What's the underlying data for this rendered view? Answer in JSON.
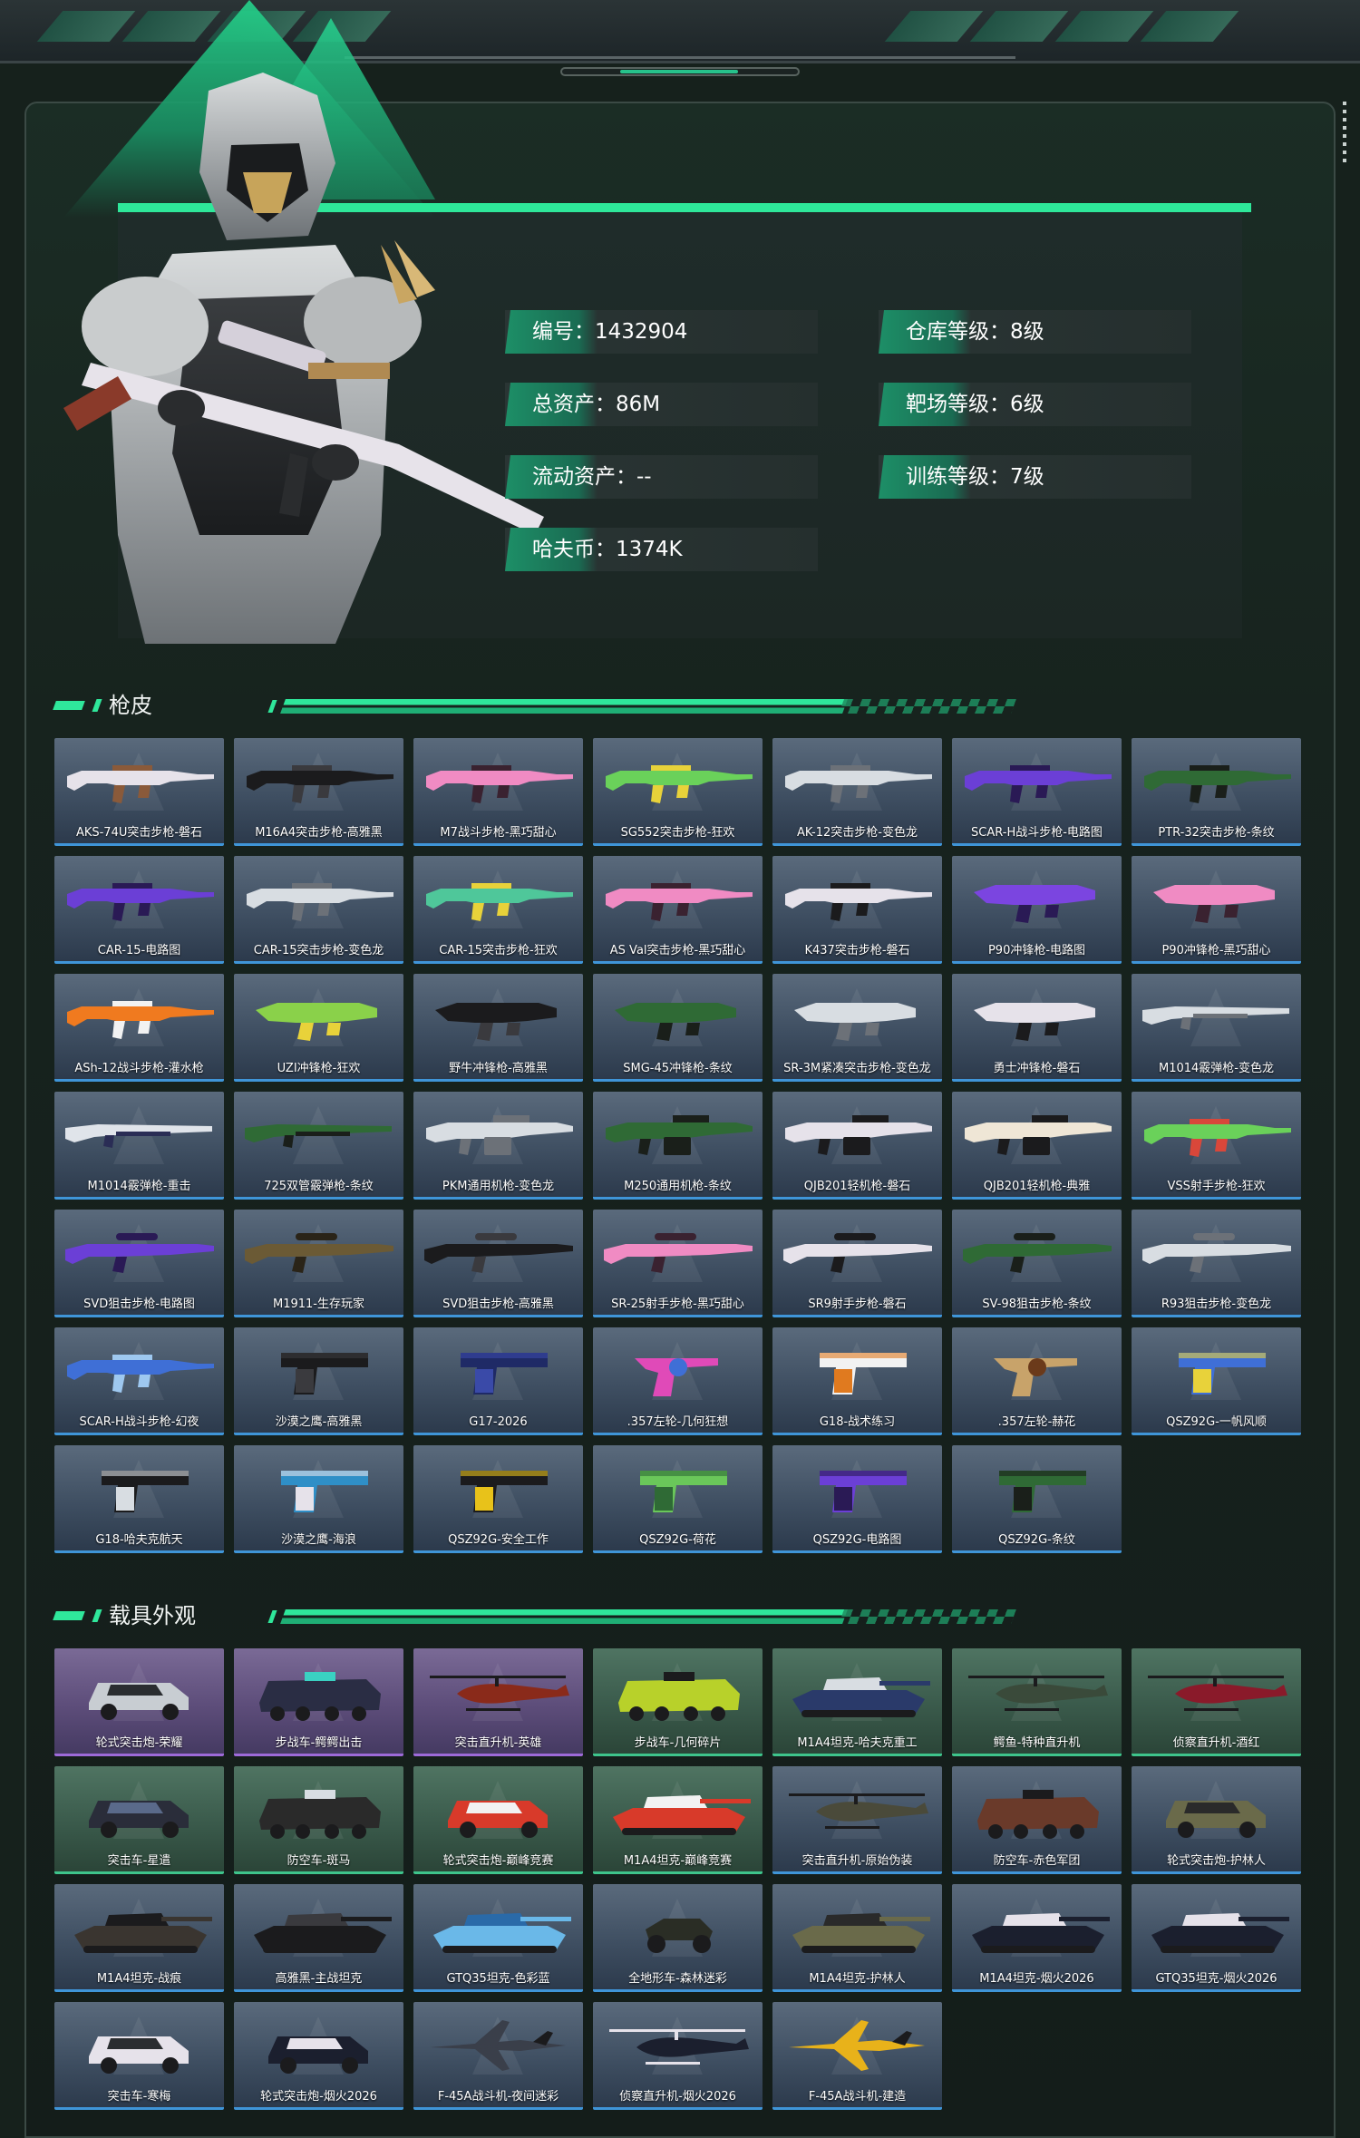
{
  "profile": {
    "stats": [
      {
        "label": "编号：1432904"
      },
      {
        "label": "仓库等级：8级"
      },
      {
        "label": "总资产：86M"
      },
      {
        "label": "靶场等级：6级"
      },
      {
        "label": "流动资产：--"
      },
      {
        "label": "训练等级：7级"
      },
      {
        "label": "哈夫币：1374K"
      }
    ]
  },
  "sections": {
    "weapons_title": "枪皮",
    "vehicles_title": "载具外观"
  },
  "weapons": [
    {
      "name": "AKS-74U突击步枪-磐石",
      "kind": "rifle",
      "color": "#e6e2ea",
      "accent": "#8a5a3a"
    },
    {
      "name": "M16A4突击步枪-高雅黑",
      "kind": "rifle",
      "color": "#1b1b1d",
      "accent": "#3a3a3e"
    },
    {
      "name": "M7战斗步枪-黑巧甜心",
      "kind": "rifle",
      "color": "#f08bc3",
      "accent": "#3a2230"
    },
    {
      "name": "SG552突击步枪-狂欢",
      "kind": "rifle",
      "color": "#6ad15a",
      "accent": "#e8d23a"
    },
    {
      "name": "AK-12突击步枪-变色龙",
      "kind": "rifle",
      "color": "#d8dde2",
      "accent": "#6c7178"
    },
    {
      "name": "SCAR-H战斗步枪-电路图",
      "kind": "rifle",
      "color": "#6b3fd6",
      "accent": "#2a1a55"
    },
    {
      "name": "PTR-32突击步枪-条纹",
      "kind": "rifle",
      "color": "#2f6a35",
      "accent": "#1a1f1a"
    },
    {
      "name": "CAR-15-电路图",
      "kind": "rifle",
      "color": "#6b3fd6",
      "accent": "#2a1a55"
    },
    {
      "name": "CAR-15突击步枪-变色龙",
      "kind": "rifle",
      "color": "#d8dde2",
      "accent": "#6c7178"
    },
    {
      "name": "CAR-15突击步枪-狂欢",
      "kind": "rifle",
      "color": "#4fc79a",
      "accent": "#e8d23a"
    },
    {
      "name": "AS Val突击步枪-黑巧甜心",
      "kind": "rifle",
      "color": "#f08bc3",
      "accent": "#3a2230"
    },
    {
      "name": "K437突击步枪-磐石",
      "kind": "rifle",
      "color": "#e6e2ea",
      "accent": "#1b1b1d"
    },
    {
      "name": "P90冲锋枪-电路图",
      "kind": "smg",
      "color": "#7b45e0",
      "accent": "#2a1a55"
    },
    {
      "name": "P90冲锋枪-黑巧甜心",
      "kind": "smg",
      "color": "#f08bc3",
      "accent": "#3a2230"
    },
    {
      "name": "ASh-12战斗步枪-灌水枪",
      "kind": "rifle",
      "color": "#f07a1f",
      "accent": "#f2f2f2"
    },
    {
      "name": "UZI冲锋枪-狂欢",
      "kind": "smg",
      "color": "#8ad14a",
      "accent": "#e8d23a"
    },
    {
      "name": "野牛冲锋枪-高雅黑",
      "kind": "smg",
      "color": "#1b1b1d",
      "accent": "#3a3a3e"
    },
    {
      "name": "SMG-45冲锋枪-条纹",
      "kind": "smg",
      "color": "#2f6a35",
      "accent": "#1a1f1a"
    },
    {
      "name": "SR-3M紧凑突击步枪-变色龙",
      "kind": "smg",
      "color": "#d8dde2",
      "accent": "#6c7178"
    },
    {
      "name": "勇士冲锋枪-磐石",
      "kind": "smg",
      "color": "#e6e2ea",
      "accent": "#1b1b1d"
    },
    {
      "name": "M1014霰弹枪-变色龙",
      "kind": "shotgun",
      "color": "#d8dde2",
      "accent": "#6c7178"
    },
    {
      "name": "M1014霰弹枪-重击",
      "kind": "shotgun",
      "color": "#e0e4ea",
      "accent": "#2a2d55"
    },
    {
      "name": "725双管霰弹枪-条纹",
      "kind": "shotgun",
      "color": "#2f6a35",
      "accent": "#1a1f1a"
    },
    {
      "name": "PKM通用机枪-变色龙",
      "kind": "mg",
      "color": "#d8dde2",
      "accent": "#6c7178"
    },
    {
      "name": "M250通用机枪-条纹",
      "kind": "mg",
      "color": "#2f6a35",
      "accent": "#1a1f1a"
    },
    {
      "name": "QJB201轻机枪-磐石",
      "kind": "mg",
      "color": "#e6e2ea",
      "accent": "#1b1b1d"
    },
    {
      "name": "QJB201轻机枪-典雅",
      "kind": "mg",
      "color": "#efe6d6",
      "accent": "#1b1b1d"
    },
    {
      "name": "VSS射手步枪-狂欢",
      "kind": "rifle",
      "color": "#6ad15a",
      "accent": "#d9473a"
    },
    {
      "name": "SVD狙击步枪-电路图",
      "kind": "sniper",
      "color": "#6b3fd6",
      "accent": "#2a1a55"
    },
    {
      "name": "M1911-生存玩家",
      "kind": "sniper",
      "color": "#6b5a35",
      "accent": "#2a2418"
    },
    {
      "name": "SVD狙击步枪-高雅黑",
      "kind": "sniper",
      "color": "#1b1b1d",
      "accent": "#3a3a3e"
    },
    {
      "name": "SR-25射手步枪-黑巧甜心",
      "kind": "sniper",
      "color": "#f08bc3",
      "accent": "#3a2230"
    },
    {
      "name": "SR9射手步枪-磐石",
      "kind": "sniper",
      "color": "#e6e2ea",
      "accent": "#1b1b1d"
    },
    {
      "name": "SV-98狙击步枪-条纹",
      "kind": "sniper",
      "color": "#2f6a35",
      "accent": "#1a1f1a"
    },
    {
      "name": "R93狙击步枪-变色龙",
      "kind": "sniper",
      "color": "#d8dde2",
      "accent": "#6c7178"
    },
    {
      "name": "SCAR-H战斗步枪-幻夜",
      "kind": "rifle",
      "color": "#3f6fd6",
      "accent": "#9ec8f0"
    },
    {
      "name": "沙漠之鹰-高雅黑",
      "kind": "pistol",
      "color": "#1b1b1d",
      "accent": "#3a3a3e"
    },
    {
      "name": "G17-2026",
      "kind": "pistol",
      "color": "#1f2a66",
      "accent": "#3a4aa8"
    },
    {
      "name": ".357左轮-几何狂想",
      "kind": "revolver",
      "color": "#e04ab8",
      "accent": "#3f6fd6"
    },
    {
      "name": "G18-战术练习",
      "kind": "pistol",
      "color": "#f2f2f2",
      "accent": "#e07a1f"
    },
    {
      "name": ".357左轮-赫花",
      "kind": "revolver",
      "color": "#c8a36a",
      "accent": "#6b3a1a"
    },
    {
      "name": "QSZ92G-一帆风顺",
      "kind": "pistol",
      "color": "#3f6fd6",
      "accent": "#e8d23a"
    },
    {
      "name": "G18-哈夫克航天",
      "kind": "pistol",
      "color": "#1b1b1d",
      "accent": "#d8dde2"
    },
    {
      "name": "沙漠之鹰-海浪",
      "kind": "pistol",
      "color": "#2f8fc7",
      "accent": "#e6e2ea"
    },
    {
      "name": "QSZ92G-安全工作",
      "kind": "pistol",
      "color": "#1b1b1d",
      "accent": "#e8c21a"
    },
    {
      "name": "QSZ92G-荷花",
      "kind": "pistol",
      "color": "#6ac75a",
      "accent": "#2f6a35"
    },
    {
      "name": "QSZ92G-电路图",
      "kind": "pistol",
      "color": "#6b3fd6",
      "accent": "#2a1a55"
    },
    {
      "name": "QSZ92G-条纹",
      "kind": "pistol",
      "color": "#2f6a35",
      "accent": "#1a1f1a"
    }
  ],
  "vehicles": [
    {
      "name": "轮式突击炮-荣耀",
      "kind": "car",
      "rarity": "purple",
      "color": "#c8cdd2",
      "accent": "#2a2d30"
    },
    {
      "name": "步战车-鳄鳄出击",
      "kind": "apc",
      "rarity": "purple",
      "color": "#2a2d44",
      "accent": "#3ad1c2"
    },
    {
      "name": "突击直升机-英雄",
      "kind": "heli",
      "rarity": "purple",
      "color": "#8a2a1a",
      "accent": "#1b1b1d"
    },
    {
      "name": "步战车-几何碎片",
      "kind": "apc",
      "rarity": "green",
      "color": "#b8d12a",
      "accent": "#1b1b1d"
    },
    {
      "name": "M1A4坦克-哈夫克重工",
      "kind": "tank",
      "rarity": "green",
      "color": "#2a3a6a",
      "accent": "#d8dde2"
    },
    {
      "name": "鳄鱼-特种直升机",
      "kind": "heli",
      "rarity": "green",
      "color": "#3a4a3a",
      "accent": "#1b1b1d"
    },
    {
      "name": "侦察直升机-酒红",
      "kind": "heli",
      "rarity": "green",
      "color": "#8a1a2a",
      "accent": "#1b1b1d"
    },
    {
      "name": "突击车-星遣",
      "kind": "car",
      "rarity": "green",
      "color": "#2a2d3a",
      "accent": "#5a6a8a"
    },
    {
      "name": "防空车-斑马",
      "kind": "apc",
      "rarity": "green",
      "color": "#2a2a2a",
      "accent": "#d8dde2"
    },
    {
      "name": "轮式突击炮-巅峰竞赛",
      "kind": "car",
      "rarity": "green",
      "color": "#d83a2a",
      "accent": "#f2f2f2"
    },
    {
      "name": "M1A4坦克-巅峰竞赛",
      "kind": "tank",
      "rarity": "green",
      "color": "#d83a2a",
      "accent": "#f2f2f2"
    },
    {
      "name": "突击直升机-原始伪装",
      "kind": "heli",
      "rarity": "blue",
      "color": "#4a4a3a",
      "accent": "#1b1b1d"
    },
    {
      "name": "防空车-赤色军团",
      "kind": "apc",
      "rarity": "blue",
      "color": "#6a3a2a",
      "accent": "#1b1b1d"
    },
    {
      "name": "轮式突击炮-护林人",
      "kind": "car",
      "rarity": "blue",
      "color": "#6a6a4a",
      "accent": "#2a2a2a"
    },
    {
      "name": "M1A4坦克-战痕",
      "kind": "tank",
      "rarity": "blue",
      "color": "#3a3530",
      "accent": "#1b1b1d"
    },
    {
      "name": "高雅黑-主战坦克",
      "kind": "tank",
      "rarity": "blue",
      "color": "#1b1b1d",
      "accent": "#3a3a3e"
    },
    {
      "name": "GTQ35坦克-色彩蓝",
      "kind": "tank",
      "rarity": "blue",
      "color": "#6ab8e8",
      "accent": "#2a6aa8"
    },
    {
      "name": "全地形车-森林迷彩",
      "kind": "atv",
      "rarity": "blue",
      "color": "#2a2d25",
      "accent": "#1b1b1d"
    },
    {
      "name": "M1A4坦克-护林人",
      "kind": "tank",
      "rarity": "blue",
      "color": "#6a6a4a",
      "accent": "#2a2a2a"
    },
    {
      "name": "M1A4坦克-烟火2026",
      "kind": "tank",
      "rarity": "blue",
      "color": "#1b1f2e",
      "accent": "#e6e2ea"
    },
    {
      "name": "GTQ35坦克-烟火2026",
      "kind": "tank",
      "rarity": "blue",
      "color": "#1b1f2e",
      "accent": "#e6e2ea"
    },
    {
      "name": "突击车-寒梅",
      "kind": "car",
      "rarity": "blue",
      "color": "#e6e2ea",
      "accent": "#2a2d30"
    },
    {
      "name": "轮式突击炮-烟火2026",
      "kind": "car",
      "rarity": "blue",
      "color": "#1b1f2e",
      "accent": "#e6e2ea"
    },
    {
      "name": "F-45A战斗机-夜间迷彩",
      "kind": "jet",
      "rarity": "blue",
      "color": "#3a3f4a",
      "accent": "#1b1b1d"
    },
    {
      "name": "侦察直升机-烟火2026",
      "kind": "heli",
      "rarity": "blue",
      "color": "#1b1f2e",
      "accent": "#e6e2ea"
    },
    {
      "name": "F-45A战斗机-建造",
      "kind": "jet",
      "rarity": "blue",
      "color": "#e8b21a",
      "accent": "#1b1b1d"
    }
  ]
}
